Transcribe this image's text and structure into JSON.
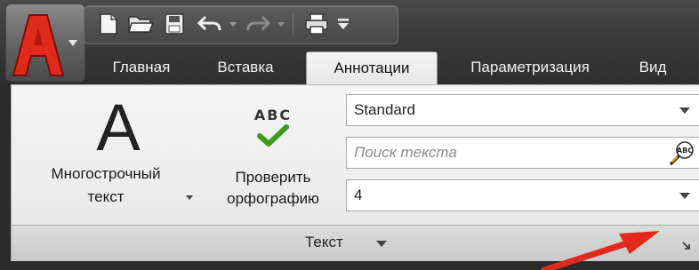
{
  "tabs": [
    "Главная",
    "Вставка",
    "Аннотации",
    "Параметризация",
    "Вид"
  ],
  "active_tab_index": 2,
  "mtext": {
    "line1": "Многострочный",
    "line2": "текст",
    "glyph": "A"
  },
  "spell": {
    "top": "ABC",
    "line1": "Проверить",
    "line2": "орфографию"
  },
  "text_style": {
    "value": "Standard"
  },
  "search": {
    "placeholder": "Поиск текста",
    "icon_text": "ABC"
  },
  "text_height": {
    "value": "4"
  },
  "panel": {
    "title": "Текст"
  },
  "colors": {
    "accent_red": "#e02a1c",
    "check_green": "#3c9a1e",
    "ribbon_bg": "#ececec"
  }
}
